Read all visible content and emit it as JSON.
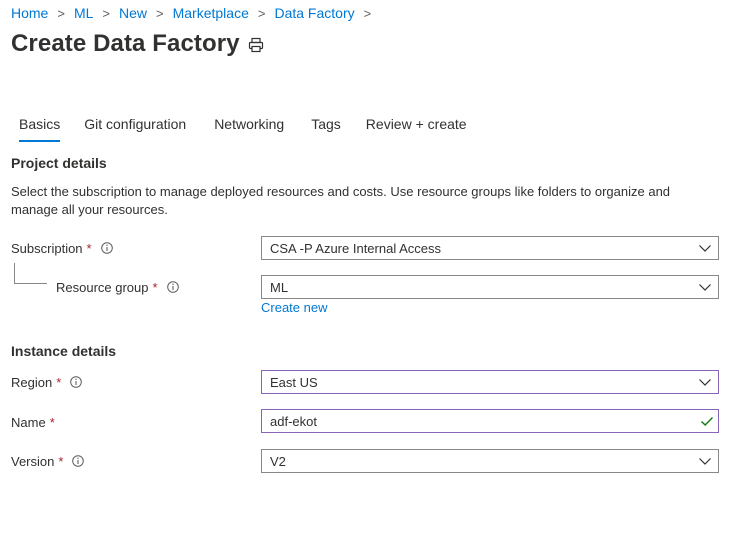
{
  "breadcrumb": {
    "items": [
      "Home",
      "ML",
      "New",
      "Marketplace",
      "Data Factory"
    ]
  },
  "page": {
    "title": "Create Data Factory"
  },
  "tabs": [
    "Basics",
    "Git configuration",
    "Networking",
    "Tags",
    "Review + create"
  ],
  "project_details": {
    "heading": "Project details",
    "description": "Select the subscription to manage deployed resources and costs. Use resource groups like folders to organize and manage all your resources.",
    "subscription": {
      "label": "Subscription",
      "required_mark": "*",
      "value": "CSA -P Azure Internal Access"
    },
    "resource_group": {
      "label": "Resource group",
      "required_mark": "*",
      "value": "ML",
      "create_new_label": "Create new"
    }
  },
  "instance_details": {
    "heading": "Instance details",
    "region": {
      "label": "Region",
      "required_mark": "*",
      "value": "East US"
    },
    "name": {
      "label": "Name",
      "required_mark": "*",
      "value": "adf-ekot"
    },
    "version": {
      "label": "Version",
      "required_mark": "*",
      "value": "V2"
    }
  },
  "colors": {
    "accent": "#0078d4",
    "required": "#a4262c",
    "focus_border": "#8764b8",
    "valid_check": "#107c10"
  }
}
